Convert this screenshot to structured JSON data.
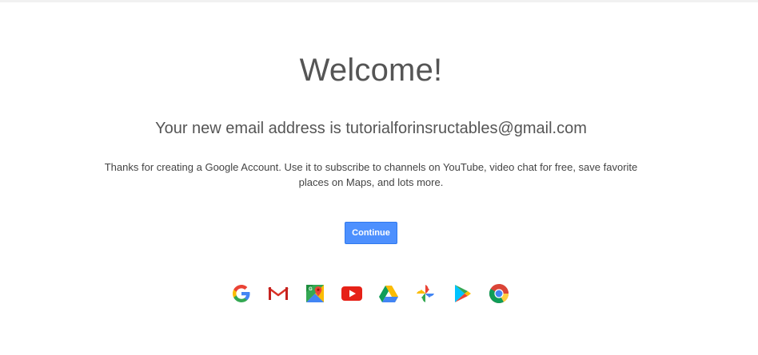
{
  "welcome": {
    "title": "Welcome!",
    "email_line": "Your new email address is tutorialforinsructables@gmail.com",
    "description": "Thanks for creating a Google Account. Use it to subscribe to channels on YouTube, video chat for free, save favorite places on Maps, and lots more."
  },
  "actions": {
    "continue_label": "Continue"
  },
  "apps": [
    {
      "icon": "google-icon"
    },
    {
      "icon": "gmail-icon"
    },
    {
      "icon": "maps-icon"
    },
    {
      "icon": "youtube-icon"
    },
    {
      "icon": "drive-icon"
    },
    {
      "icon": "photos-icon"
    },
    {
      "icon": "play-store-icon"
    },
    {
      "icon": "chrome-icon"
    }
  ],
  "colors": {
    "accent_blue": "#4d90fe",
    "google_red": "#ea4335",
    "google_yellow": "#fbbc05",
    "google_green": "#34a853",
    "google_blue": "#4285f4"
  }
}
